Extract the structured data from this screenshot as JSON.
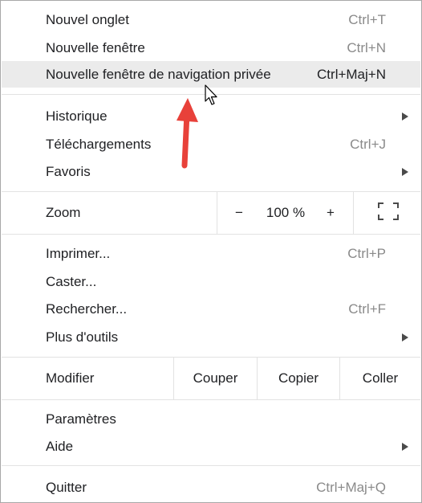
{
  "menu": {
    "new_tab": {
      "label": "Nouvel onglet",
      "shortcut": "Ctrl+T"
    },
    "new_window": {
      "label": "Nouvelle fenêtre",
      "shortcut": "Ctrl+N"
    },
    "new_private_window": {
      "label": "Nouvelle fenêtre de navigation privée",
      "shortcut": "Ctrl+Maj+N"
    },
    "history": {
      "label": "Historique"
    },
    "downloads": {
      "label": "Téléchargements",
      "shortcut": "Ctrl+J"
    },
    "bookmarks": {
      "label": "Favoris"
    },
    "zoom": {
      "label": "Zoom",
      "minus": "−",
      "value": "100 %",
      "plus": "+",
      "fullscreen_icon": "fullscreen-icon"
    },
    "print": {
      "label": "Imprimer...",
      "shortcut": "Ctrl+P"
    },
    "cast": {
      "label": "Caster..."
    },
    "find": {
      "label": "Rechercher...",
      "shortcut": "Ctrl+F"
    },
    "more_tools": {
      "label": "Plus d'outils"
    },
    "edit": {
      "label": "Modifier",
      "cut": "Couper",
      "copy": "Copier",
      "paste": "Coller"
    },
    "settings": {
      "label": "Paramètres"
    },
    "help": {
      "label": "Aide"
    },
    "quit": {
      "label": "Quitter",
      "shortcut": "Ctrl+Maj+Q"
    }
  },
  "colors": {
    "highlight": "#ebebeb",
    "arrow": "#e8413a",
    "separator": "#e2e2e2"
  }
}
